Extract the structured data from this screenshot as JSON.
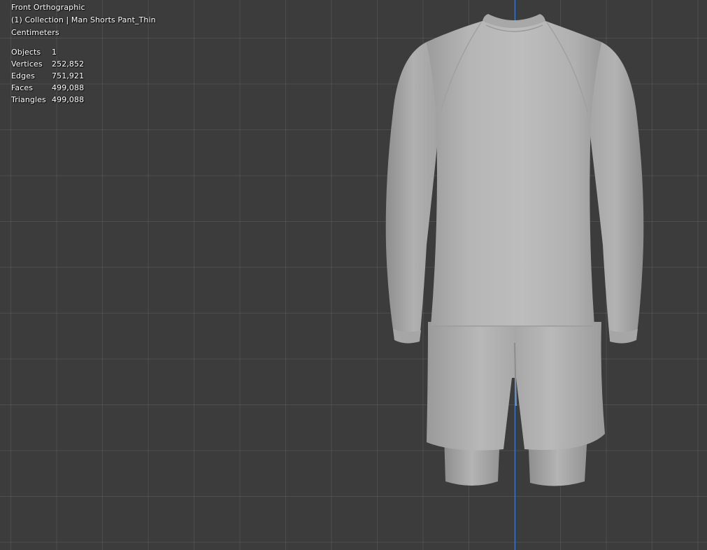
{
  "viewport": {
    "view_name": "Front Orthographic",
    "collection_line": "(1) Collection | Man Shorts Pant_Thin",
    "units": "Centimeters",
    "background_color": "#3c3c3c",
    "axis_color": "#3f7fd6",
    "stats": [
      {
        "label": "Objects",
        "value": "1"
      },
      {
        "label": "Vertices",
        "value": "252,852"
      },
      {
        "label": "Edges",
        "value": "751,921"
      },
      {
        "label": "Faces",
        "value": "499,088"
      },
      {
        "label": "Triangles",
        "value": "499,088"
      }
    ]
  },
  "model": {
    "description_icon": "garment-mesh",
    "fabric_color": "#b4b4b4"
  }
}
